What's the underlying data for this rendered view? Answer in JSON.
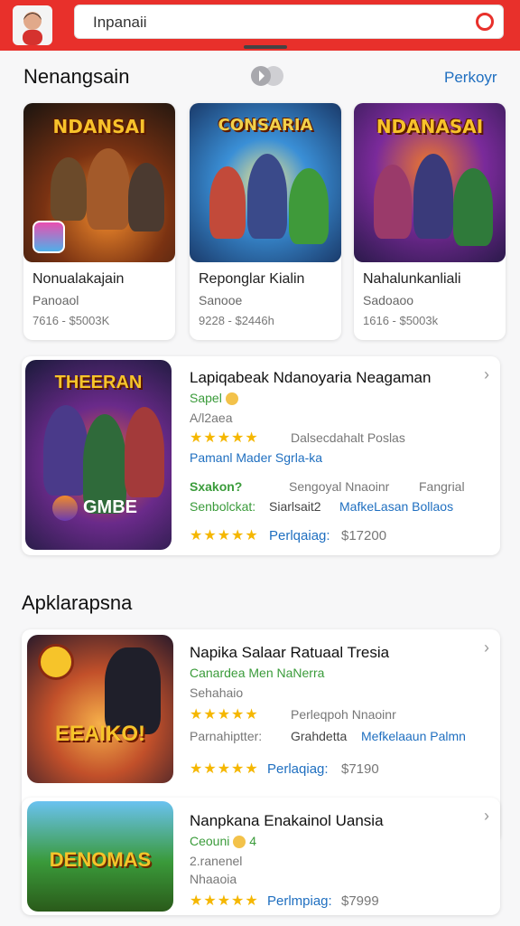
{
  "header": {
    "search_value": "Inpanaii"
  },
  "featured": {
    "title": "Nenangsain",
    "more": "Perkoyr",
    "cards": [
      {
        "banner": "NDANSAI",
        "name": "Nonualakajain",
        "dev": "Panoaol",
        "meta": "7616 - $5003K"
      },
      {
        "banner": "CONSARIA",
        "name": "Reponglar Kialin",
        "dev": "Sanooe",
        "meta": "9228 - $2446h"
      },
      {
        "banner": "NDANASAI",
        "name": "Nahalunkanliali",
        "dev": "Sadoaoo",
        "meta": "1616 - $5003k"
      }
    ]
  },
  "promo": {
    "banner": "THEERAN",
    "logo": "GMBE",
    "title": "Lapiqabeak Ndanoyaria Neagaman",
    "sub": "Sapel",
    "meta": "A/l2aea",
    "rating_text": "Dalsecdahalt Poslas",
    "link1": "Pamanl Mader Sgrla-ka",
    "row1_a": "Sxakon?",
    "row1_b": "Sengoyal Nnaoinr",
    "row1_c": "Fangrial",
    "row2_a": "Senbolckat:",
    "row2_b": "Siarlsait2",
    "row2_c": "MafkeLasan Bollaos",
    "price_label": "Perlqaiag:",
    "price": "$17200"
  },
  "apps": {
    "title": "Apklarapsna",
    "items": [
      {
        "banner": "EEAIKO!",
        "title": "Napika Salaar Ratuaal Tresia",
        "sub": "Canardea Men NaNerra",
        "meta": "Sehahaio",
        "rating_text": "Perleqpoh Nnaoinr",
        "row_a": "Parnahiptter:",
        "row_b": "Grahdetta",
        "row_c": "Mefkelaaun Palmn",
        "price_label": "Perlaqiag:",
        "price": "$7190"
      },
      {
        "banner": "DENOMAS",
        "title": "Nanpkana Enakainol Uansia",
        "sub": "Ceouni",
        "sub_num": "4",
        "meta": "2.ranenel",
        "meta2": "Nhaaoia",
        "price_label": "Perlmpiag:",
        "price": "$7999"
      }
    ]
  },
  "colors": {
    "brand": "#e8302b",
    "link": "#1f6fc0",
    "accent_green": "#3a9b3a",
    "star": "#f5b700"
  },
  "icons": [
    "user-avatar-icon",
    "search-ring-icon",
    "chevron-right-icon",
    "star-icon",
    "play-toggle-icon"
  ]
}
